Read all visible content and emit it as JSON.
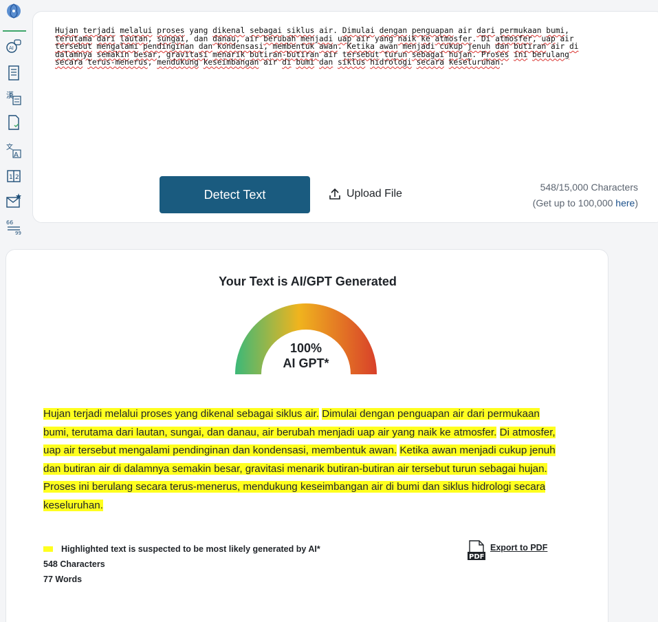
{
  "sidebar": {
    "icons": [
      "brain-logo-icon",
      "ai-chat-icon",
      "document-list-icon",
      "translate-text-icon",
      "document-check-icon",
      "language-icon",
      "compare-icon",
      "mail-star-icon",
      "quote-icon"
    ]
  },
  "input": {
    "segments": [
      [
        "Hujan",
        true
      ],
      [
        " ",
        false
      ],
      [
        "terjadi",
        true
      ],
      [
        " ",
        false
      ],
      [
        "melalui",
        true
      ],
      [
        " ",
        false
      ],
      [
        "proses",
        true
      ],
      [
        " yang ",
        false
      ],
      [
        "dikenal",
        true
      ],
      [
        " ",
        false
      ],
      [
        "sebagai",
        true
      ],
      [
        " ",
        false
      ],
      [
        "siklus",
        true
      ],
      [
        " air. ",
        false
      ],
      [
        "Dimulai",
        true
      ],
      [
        " ",
        false
      ],
      [
        "dengan",
        true
      ],
      [
        " ",
        false
      ],
      [
        "penguapan",
        true
      ],
      [
        " air ",
        false
      ],
      [
        "dari",
        true
      ],
      [
        " ",
        false
      ],
      [
        "permukaan",
        true
      ],
      [
        " ",
        false
      ],
      [
        "bumi",
        true
      ],
      [
        ",\n",
        false
      ],
      [
        "terutama",
        true
      ],
      [
        " ",
        false
      ],
      [
        "dari",
        true
      ],
      [
        " ",
        false
      ],
      [
        "lautan",
        true
      ],
      [
        ", ",
        false
      ],
      [
        "sungai",
        true
      ],
      [
        ", dan ",
        false
      ],
      [
        "danau",
        true
      ],
      [
        ", air ",
        false
      ],
      [
        "berubah",
        true
      ],
      [
        " ",
        false
      ],
      [
        "menjadi",
        true
      ],
      [
        " ",
        false
      ],
      [
        "uap",
        true
      ],
      [
        " air yang ",
        false
      ],
      [
        "naik",
        true
      ],
      [
        " ",
        false
      ],
      [
        "ke",
        true
      ],
      [
        " ",
        false
      ],
      [
        "atmosfer",
        true
      ],
      [
        ". Di ",
        false
      ],
      [
        "atmosfer",
        true
      ],
      [
        ", ",
        false
      ],
      [
        "uap",
        true
      ],
      [
        " air\n",
        false
      ],
      [
        "tersebut",
        true
      ],
      [
        " ",
        false
      ],
      [
        "mengalami",
        true
      ],
      [
        " ",
        false
      ],
      [
        "pendinginan",
        true
      ],
      [
        " ",
        false
      ],
      [
        "dan",
        true
      ],
      [
        " ",
        false
      ],
      [
        "kondensasi",
        true
      ],
      [
        ", ",
        false
      ],
      [
        "membentuk",
        true
      ],
      [
        " ",
        false
      ],
      [
        "awan",
        true
      ],
      [
        ". ",
        false
      ],
      [
        "Ketika",
        true
      ],
      [
        " ",
        false
      ],
      [
        "awan",
        true
      ],
      [
        " ",
        false
      ],
      [
        "menjadi",
        true
      ],
      [
        " ",
        false
      ],
      [
        "cukup",
        true
      ],
      [
        " ",
        false
      ],
      [
        "jenuh",
        true
      ],
      [
        " ",
        false
      ],
      [
        "dan",
        true
      ],
      [
        " ",
        false
      ],
      [
        "butiran",
        true
      ],
      [
        " air ",
        false
      ],
      [
        "di",
        true
      ],
      [
        "\n",
        false
      ],
      [
        "dalamnya",
        true
      ],
      [
        " ",
        false
      ],
      [
        "semakin",
        true
      ],
      [
        " ",
        false
      ],
      [
        "besar",
        true
      ],
      [
        ", ",
        false
      ],
      [
        "gravitasi",
        true
      ],
      [
        " ",
        false
      ],
      [
        "menarik",
        true
      ],
      [
        " ",
        false
      ],
      [
        "butiran-butiran",
        true
      ],
      [
        " air ",
        false
      ],
      [
        "tersebut",
        true
      ],
      [
        " ",
        false
      ],
      [
        "turun",
        true
      ],
      [
        " ",
        false
      ],
      [
        "sebagai",
        true
      ],
      [
        " ",
        false
      ],
      [
        "hujan",
        true
      ],
      [
        ". ",
        false
      ],
      [
        "Proses",
        true
      ],
      [
        " ",
        false
      ],
      [
        "ini",
        true
      ],
      [
        " ",
        false
      ],
      [
        "berulang",
        true
      ],
      [
        "\n",
        false
      ],
      [
        "secara",
        true
      ],
      [
        " ",
        false
      ],
      [
        "terus-menerus",
        true
      ],
      [
        ", ",
        false
      ],
      [
        "mendukung",
        true
      ],
      [
        " ",
        false
      ],
      [
        "keseimbangan",
        true
      ],
      [
        " air ",
        false
      ],
      [
        "di",
        true
      ],
      [
        " ",
        false
      ],
      [
        "bumi",
        true
      ],
      [
        " ",
        false
      ],
      [
        "dan",
        true
      ],
      [
        " ",
        false
      ],
      [
        "siklus",
        true
      ],
      [
        " ",
        false
      ],
      [
        "hidrologi",
        true
      ],
      [
        " ",
        false
      ],
      [
        "secara",
        true
      ],
      [
        " ",
        false
      ],
      [
        "keseluruhan",
        true
      ],
      [
        ".",
        false
      ]
    ]
  },
  "actions": {
    "detect_label": "Detect Text",
    "upload_label": "Upload File"
  },
  "char_count": {
    "count_text": "548/15,000 Characters",
    "upsell_prefix": "(Get up to 100,000 ",
    "upsell_link": "here",
    "upsell_suffix": ")"
  },
  "result": {
    "title": "Your Text is AI/GPT Generated",
    "gauge_percent": "100%",
    "gauge_label": "AI GPT*",
    "ai_fraction": 1.0,
    "gauge_colors": [
      "#3cb878",
      "#f0b41e",
      "#d8402a"
    ],
    "sentences": [
      "Hujan terjadi melalui proses yang dikenal sebagai siklus air.",
      "Dimulai dengan penguapan air dari permukaan bumi, terutama dari lautan, sungai, dan danau, air berubah menjadi uap air yang naik ke atmosfer.",
      "Di atmosfer, uap air tersebut mengalami pendinginan dan kondensasi, membentuk awan.",
      "Ketika awan menjadi cukup jenuh dan butiran air di dalamnya semakin besar, gravitasi menarik butiran-butiran air tersebut turun sebagai hujan.",
      "Proses ini berulang secara terus-menerus, mendukung keseimbangan air di bumi dan siklus hidrologi secara keseluruhan."
    ],
    "legend_text": "Highlighted text is suspected to be most likely generated by AI*",
    "characters": "548 Characters",
    "words": "77 Words",
    "export_label": "Export to PDF",
    "highlight_color": "#ffff1f"
  }
}
